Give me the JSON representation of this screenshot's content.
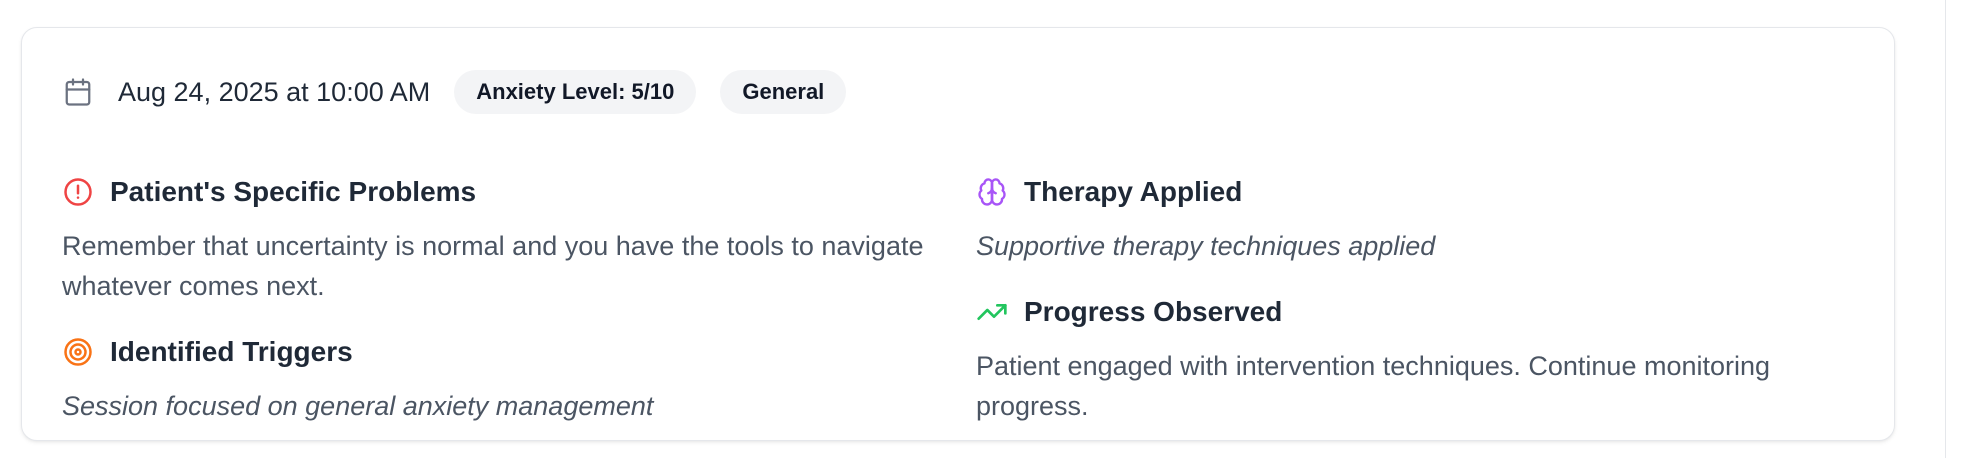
{
  "session": {
    "date": "Aug 24, 2025 at 10:00 AM",
    "badges": [
      "Anxiety Level: 5/10",
      "General"
    ]
  },
  "sections": {
    "problems": {
      "icon": "alert-circle-icon",
      "icon_color": "#ef4444",
      "title": "Patient's Specific Problems",
      "body": "Remember that uncertainty is normal and you have the tools to navigate whatever comes next."
    },
    "triggers": {
      "icon": "target-icon",
      "icon_color": "#f97316",
      "title": "Identified Triggers",
      "body": "Session focused on general anxiety management"
    },
    "therapy": {
      "icon": "brain-icon",
      "icon_color": "#a855f7",
      "title": "Therapy Applied",
      "body": "Supportive therapy techniques applied"
    },
    "progress": {
      "icon": "trending-up-icon",
      "icon_color": "#22c55e",
      "title": "Progress Observed",
      "body": "Patient engaged with intervention techniques. Continue monitoring progress."
    }
  }
}
